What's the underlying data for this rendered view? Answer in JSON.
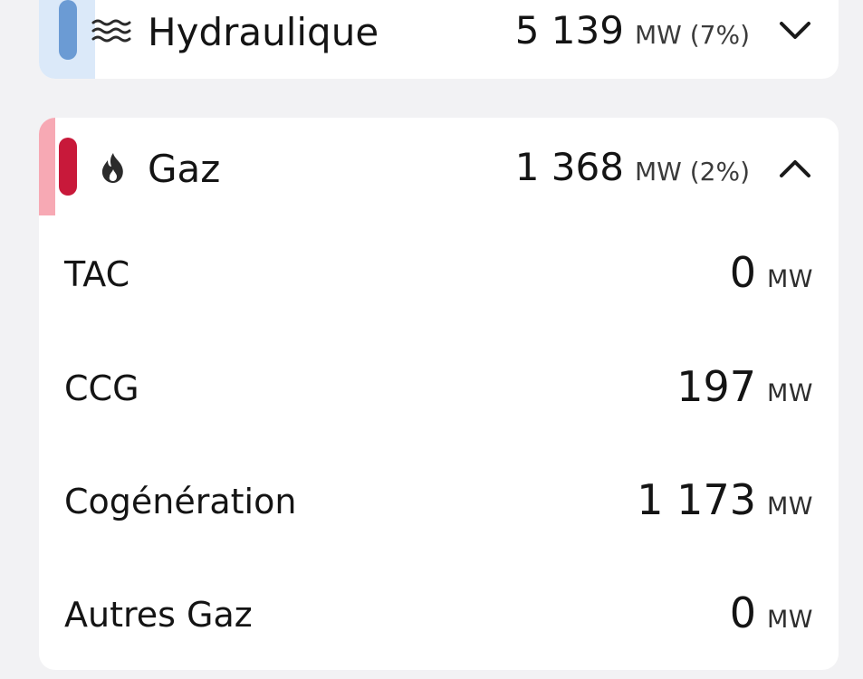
{
  "colors": {
    "hydro_accent": "#6b9bd4",
    "hydro_strip": "#dbe9f9",
    "gaz_accent": "#c8193a",
    "gaz_strip": "#f7a9b4"
  },
  "hydraulique": {
    "icon": "waves-icon",
    "title": "Hydraulique",
    "value": "5 139",
    "unit_pct": "MW (7%)",
    "chevron": "chevron-down-icon"
  },
  "gaz": {
    "icon": "flame-icon",
    "title": "Gaz",
    "value": "1 368",
    "unit_pct": "MW (2%)",
    "chevron": "chevron-up-icon",
    "rows": [
      {
        "label": "TAC",
        "value": "0",
        "unit": "MW"
      },
      {
        "label": "CCG",
        "value": "197",
        "unit": "MW"
      },
      {
        "label": "Cogénération",
        "value": "1 173",
        "unit": "MW"
      },
      {
        "label": "Autres Gaz",
        "value": "0",
        "unit": "MW"
      }
    ]
  }
}
